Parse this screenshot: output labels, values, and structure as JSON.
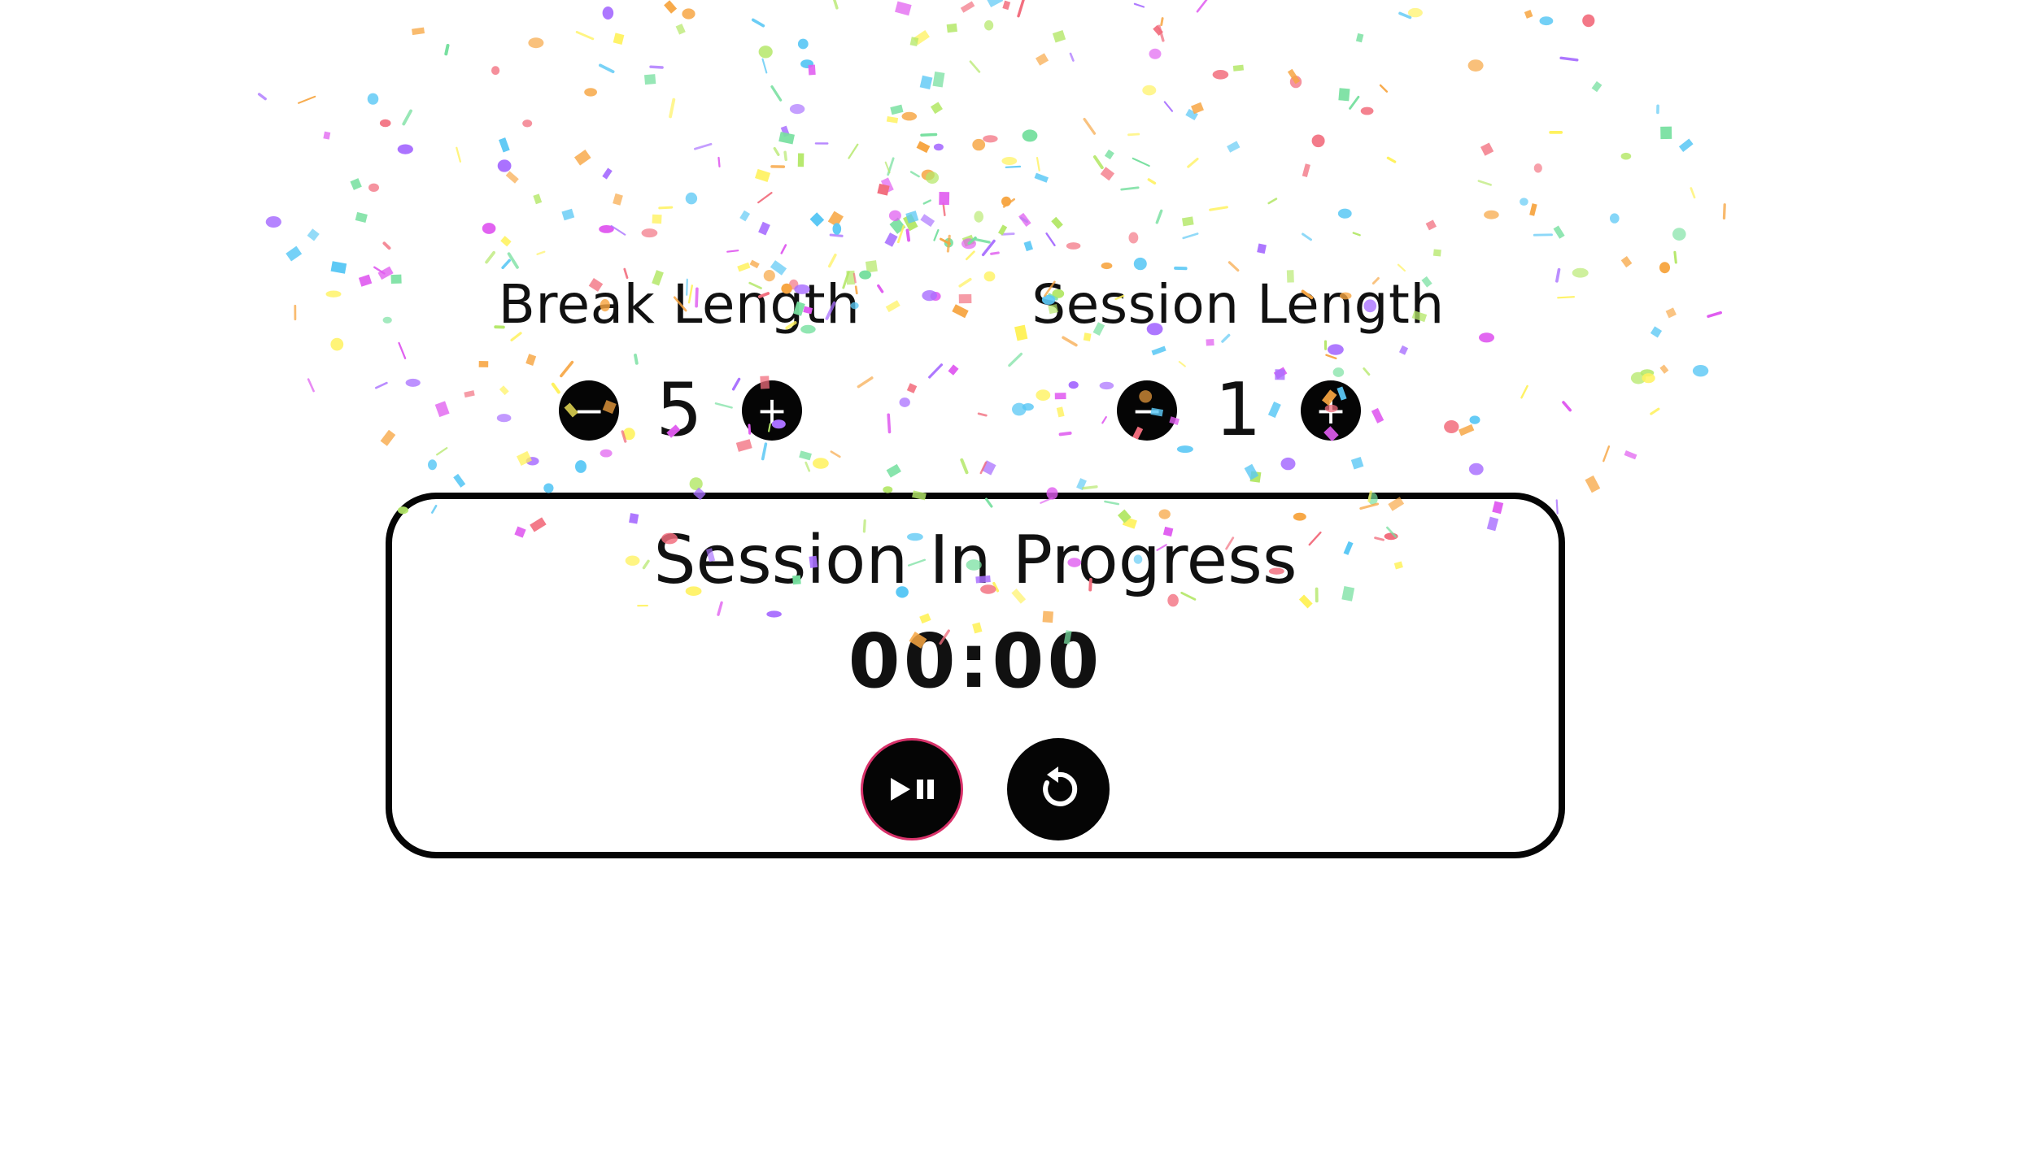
{
  "break": {
    "label": "Break Length",
    "value": "5",
    "decrement_symbol": "−",
    "increment_symbol": "+"
  },
  "session": {
    "label": "Session Length",
    "value": "1",
    "decrement_symbol": "−",
    "increment_symbol": "+"
  },
  "timer": {
    "label": "Session In Progress",
    "time": "00:00",
    "play_pause_icon": "play-pause-icon",
    "reset_icon": "reset-icon",
    "play_pause_ring_color": "#d8326a"
  },
  "confetti_colors": [
    "#f26d7d",
    "#f7a541",
    "#fff25c",
    "#b5e86a",
    "#5bc8f5",
    "#a970ff",
    "#e05cf0",
    "#78e0a0"
  ]
}
